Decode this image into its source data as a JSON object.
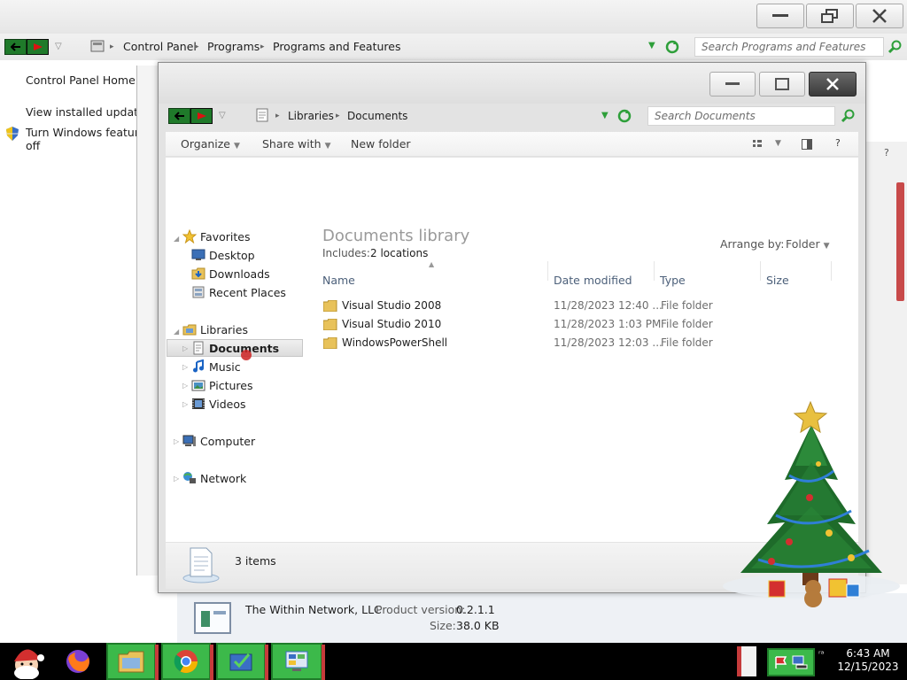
{
  "control_panel": {
    "breadcrumb": [
      "Control Panel",
      "Programs",
      "Programs and Features"
    ],
    "search_placeholder": "Search Programs and Features",
    "sidebar": {
      "home": "Control Panel Home",
      "view_updates": "View installed updates",
      "features_line1": "Turn Windows features on or",
      "features_line2": "off"
    },
    "details": {
      "publisher": "The Within Network, LLC",
      "version_label": "Product version:",
      "version_value": "0.2.1.1",
      "size_label": "Size:",
      "size_value": "38.0 KB"
    }
  },
  "explorer": {
    "breadcrumb": [
      "Libraries",
      "Documents"
    ],
    "search_placeholder": "Search Documents",
    "toolbar": {
      "organize": "Organize",
      "share_with": "Share with",
      "new_folder": "New folder",
      "help": "?"
    },
    "nav": {
      "favorites": "Favorites",
      "desktop": "Desktop",
      "downloads": "Downloads",
      "recent_places": "Recent Places",
      "libraries": "Libraries",
      "documents": "Documents",
      "music": "Music",
      "pictures": "Pictures",
      "videos": "Videos",
      "computer": "Computer",
      "network": "Network"
    },
    "library": {
      "title": "Documents library",
      "includes_label": "Includes:",
      "includes_value": "2 locations",
      "arrange_label": "Arrange by:",
      "arrange_value": "Folder"
    },
    "columns": [
      "Name",
      "Date modified",
      "Type",
      "Size"
    ],
    "rows": [
      {
        "name": "Visual Studio 2008",
        "date": "11/28/2023 12:40 ...",
        "type": "File folder"
      },
      {
        "name": "Visual Studio 2010",
        "date": "11/28/2023 1:03 PM",
        "type": "File folder"
      },
      {
        "name": "WindowsPowerShell",
        "date": "11/28/2023 12:03 ...",
        "type": "File folder"
      }
    ],
    "status": "3 items"
  },
  "taskbar": {
    "time": "6:43 AM",
    "date": "12/15/2023"
  },
  "colors": {
    "nav_back": "#1f7a2a",
    "taskbar_green": "#3cb94a",
    "link_header": "#4c607a"
  }
}
